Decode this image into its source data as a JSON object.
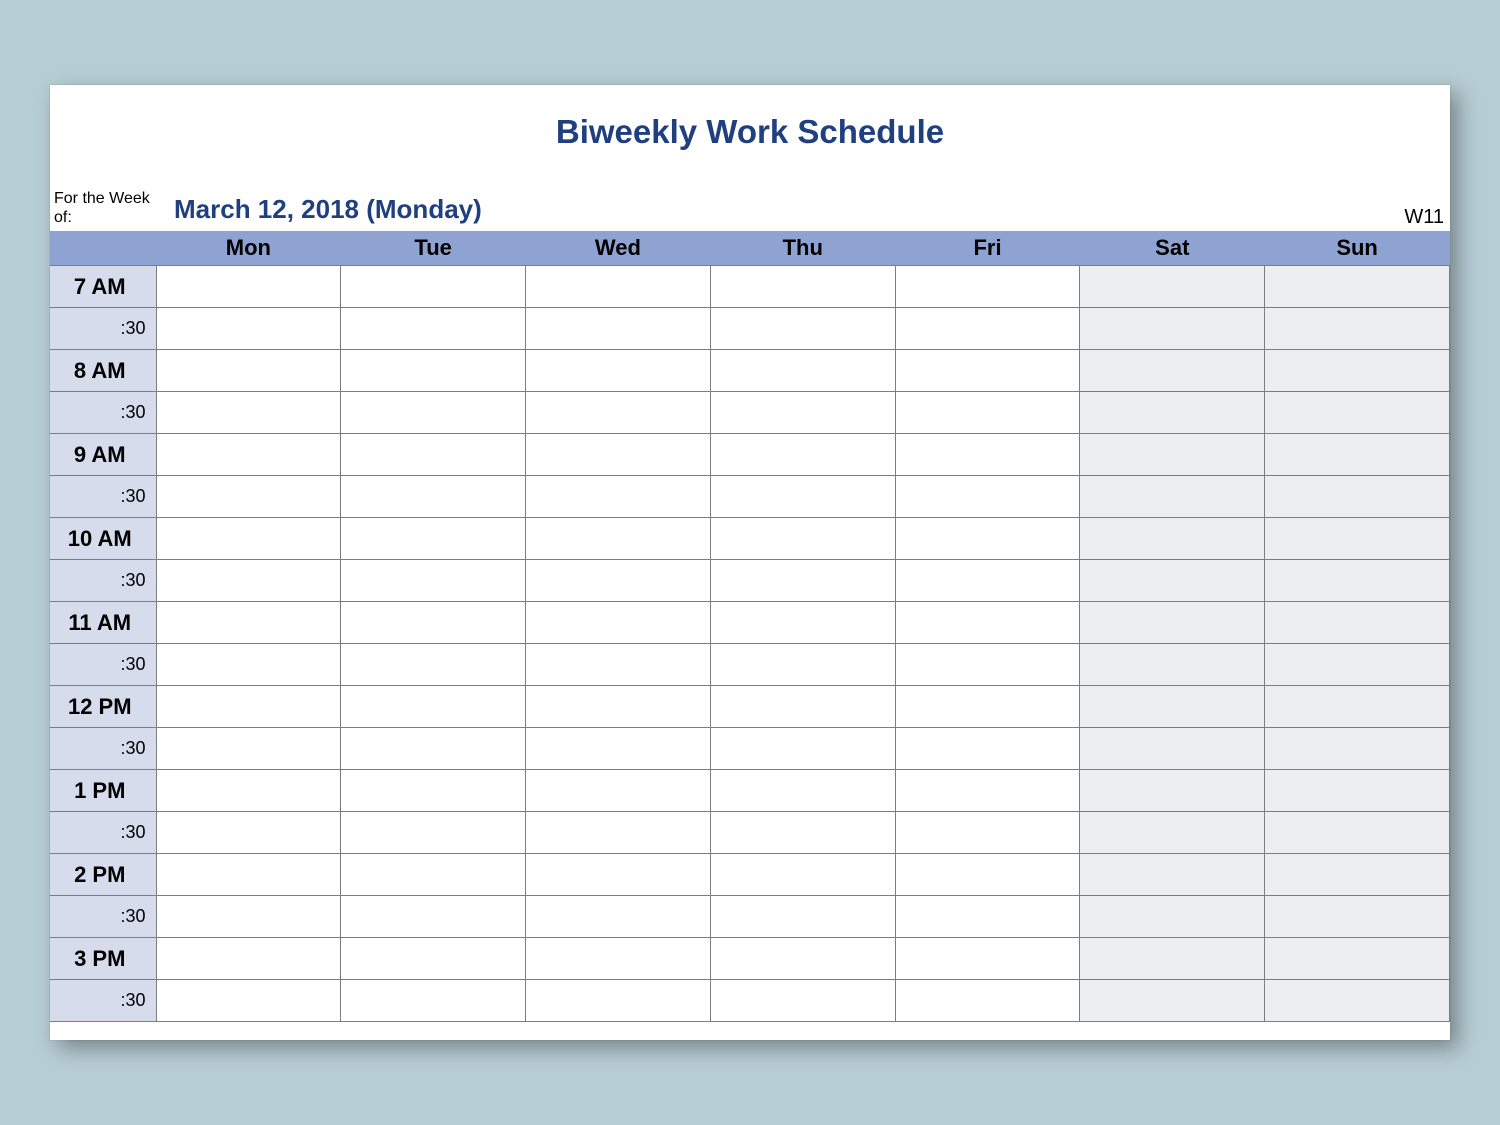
{
  "title": "Biweekly Work Schedule",
  "meta": {
    "for_week_label": "For the Week of:",
    "for_week_value": "March 12, 2018 (Monday)",
    "week_number": "W11"
  },
  "days": [
    "Mon",
    "Tue",
    "Wed",
    "Thu",
    "Fri",
    "Sat",
    "Sun"
  ],
  "weekend_indices": [
    5,
    6
  ],
  "hours": [
    {
      "label": "7 AM",
      "half": ":30"
    },
    {
      "label": "8 AM",
      "half": ":30"
    },
    {
      "label": "9 AM",
      "half": ":30"
    },
    {
      "label": "10 AM",
      "half": ":30"
    },
    {
      "label": "11 AM",
      "half": ":30"
    },
    {
      "label": "12 PM",
      "half": ":30"
    },
    {
      "label": "1 PM",
      "half": ":30"
    },
    {
      "label": "2 PM",
      "half": ":30"
    },
    {
      "label": "3 PM",
      "half": ":30"
    }
  ]
}
